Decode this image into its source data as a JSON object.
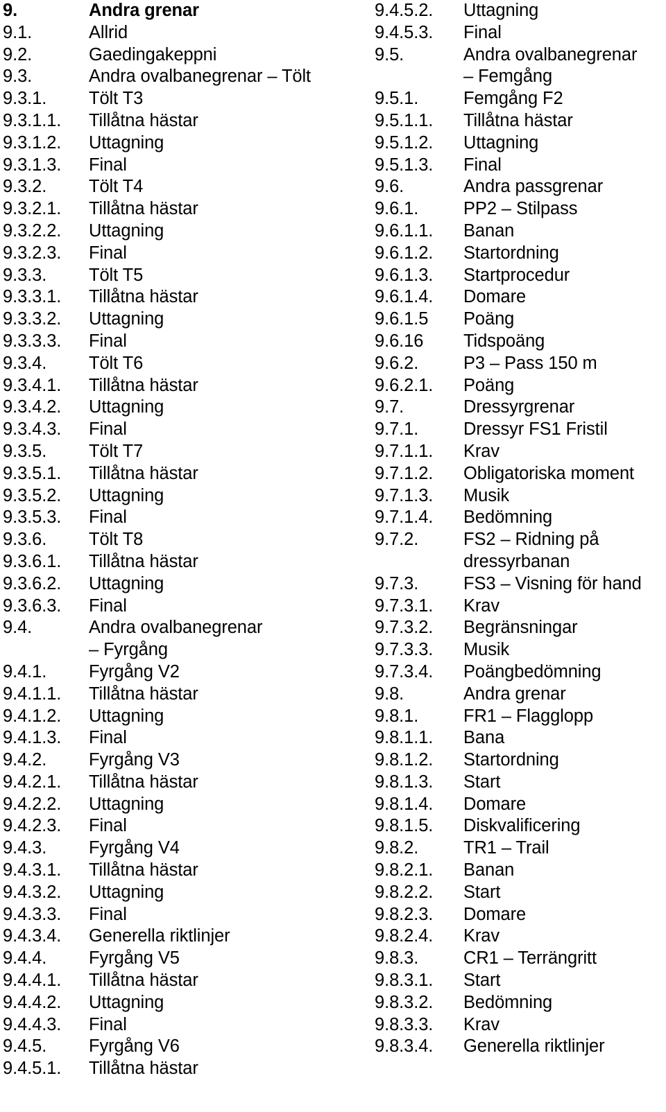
{
  "document": {
    "type": "table-of-contents",
    "language": "sv",
    "heading_number": "9.",
    "heading_label": "Andra grenar"
  },
  "columns": {
    "left": {
      "name": "left-column",
      "entries": [
        {
          "num": "9.",
          "label": "Andra grenar",
          "bold": true
        },
        {
          "num": "9.1.",
          "label": "Allrid",
          "bold": false
        },
        {
          "num": "9.2.",
          "label": "Gaedingakeppni",
          "bold": false
        },
        {
          "num": "9.3.",
          "label": "Andra ovalbanegrenar – Tölt",
          "bold": false
        },
        {
          "num": "9.3.1.",
          "label": "Tölt T3",
          "bold": false
        },
        {
          "num": "9.3.1.1.",
          "label": "Tillåtna hästar",
          "bold": false
        },
        {
          "num": "9.3.1.2.",
          "label": "Uttagning",
          "bold": false
        },
        {
          "num": "9.3.1.3.",
          "label": "Final",
          "bold": false
        },
        {
          "num": "9.3.2.",
          "label": "Tölt T4",
          "bold": false
        },
        {
          "num": "9.3.2.1.",
          "label": "Tillåtna hästar",
          "bold": false
        },
        {
          "num": "9.3.2.2.",
          "label": "Uttagning",
          "bold": false
        },
        {
          "num": "9.3.2.3.",
          "label": "Final",
          "bold": false
        },
        {
          "num": "9.3.3.",
          "label": "Tölt T5",
          "bold": false
        },
        {
          "num": "9.3.3.1.",
          "label": "Tillåtna hästar",
          "bold": false
        },
        {
          "num": "9.3.3.2.",
          "label": "Uttagning",
          "bold": false
        },
        {
          "num": "9.3.3.3.",
          "label": "Final",
          "bold": false
        },
        {
          "num": "9.3.4.",
          "label": "Tölt T6",
          "bold": false
        },
        {
          "num": "9.3.4.1.",
          "label": "Tillåtna hästar",
          "bold": false
        },
        {
          "num": "9.3.4.2.",
          "label": "Uttagning",
          "bold": false
        },
        {
          "num": "9.3.4.3.",
          "label": "Final",
          "bold": false
        },
        {
          "num": "9.3.5.",
          "label": "Tölt T7",
          "bold": false
        },
        {
          "num": "9.3.5.1.",
          "label": "Tillåtna hästar",
          "bold": false
        },
        {
          "num": "9.3.5.2.",
          "label": "Uttagning",
          "bold": false
        },
        {
          "num": "9.3.5.3.",
          "label": "Final",
          "bold": false
        },
        {
          "num": "9.3.6.",
          "label": "Tölt T8",
          "bold": false
        },
        {
          "num": "9.3.6.1.",
          "label": "Tillåtna hästar",
          "bold": false
        },
        {
          "num": "9.3.6.2.",
          "label": "Uttagning",
          "bold": false
        },
        {
          "num": "9.3.6.3.",
          "label": "Final",
          "bold": false
        },
        {
          "num": "9.4.",
          "label": "Andra ovalbanegrenar\n– Fyrgång",
          "bold": false
        },
        {
          "num": "9.4.1.",
          "label": "Fyrgång V2",
          "bold": false
        },
        {
          "num": "9.4.1.1.",
          "label": "Tillåtna hästar",
          "bold": false
        },
        {
          "num": "9.4.1.2.",
          "label": "Uttagning",
          "bold": false
        },
        {
          "num": "9.4.1.3.",
          "label": "Final",
          "bold": false
        },
        {
          "num": "9.4.2.",
          "label": "Fyrgång V3",
          "bold": false
        },
        {
          "num": "9.4.2.1.",
          "label": "Tillåtna hästar",
          "bold": false
        },
        {
          "num": "9.4.2.2.",
          "label": "Uttagning",
          "bold": false
        },
        {
          "num": "9.4.2.3.",
          "label": "Final",
          "bold": false
        },
        {
          "num": "9.4.3.",
          "label": "Fyrgång V4",
          "bold": false
        },
        {
          "num": "9.4.3.1.",
          "label": "Tillåtna hästar",
          "bold": false
        },
        {
          "num": "9.4.3.2.",
          "label": "Uttagning",
          "bold": false
        },
        {
          "num": "9.4.3.3.",
          "label": "Final",
          "bold": false
        },
        {
          "num": "9.4.3.4.",
          "label": "Generella riktlinjer",
          "bold": false
        },
        {
          "num": "9.4.4.",
          "label": "Fyrgång V5",
          "bold": false
        },
        {
          "num": "9.4.4.1.",
          "label": "Tillåtna hästar",
          "bold": false
        },
        {
          "num": "9.4.4.2.",
          "label": "Uttagning",
          "bold": false
        },
        {
          "num": "9.4.4.3.",
          "label": "Final",
          "bold": false
        },
        {
          "num": "9.4.5.",
          "label": "Fyrgång V6",
          "bold": false
        },
        {
          "num": "9.4.5.1.",
          "label": "Tillåtna hästar",
          "bold": false
        }
      ]
    },
    "right": {
      "name": "right-column",
      "entries": [
        {
          "num": "9.4.5.2.",
          "label": "Uttagning",
          "bold": false
        },
        {
          "num": "9.4.5.3.",
          "label": "Final",
          "bold": false
        },
        {
          "num": "9.5.",
          "label": "Andra ovalbanegrenar\n– Femgång",
          "bold": false
        },
        {
          "num": "9.5.1.",
          "label": "Femgång F2",
          "bold": false
        },
        {
          "num": "9.5.1.1.",
          "label": "Tillåtna hästar",
          "bold": false
        },
        {
          "num": "9.5.1.2.",
          "label": "Uttagning",
          "bold": false
        },
        {
          "num": "9.5.1.3.",
          "label": "Final",
          "bold": false
        },
        {
          "num": "9.6.",
          "label": "Andra passgrenar",
          "bold": false
        },
        {
          "num": "9.6.1.",
          "label": "PP2 – Stilpass",
          "bold": false
        },
        {
          "num": "9.6.1.1.",
          "label": "Banan",
          "bold": false
        },
        {
          "num": "9.6.1.2.",
          "label": "Startordning",
          "bold": false
        },
        {
          "num": "9.6.1.3.",
          "label": "Startprocedur",
          "bold": false
        },
        {
          "num": "9.6.1.4.",
          "label": "Domare",
          "bold": false
        },
        {
          "num": "9.6.1.5",
          "label": "Poäng",
          "bold": false
        },
        {
          "num": "9.6.16",
          "label": "Tidspoäng",
          "bold": false
        },
        {
          "num": "9.6.2.",
          "label": "P3 – Pass 150 m",
          "bold": false
        },
        {
          "num": "9.6.2.1.",
          "label": "Poäng",
          "bold": false
        },
        {
          "num": "9.7.",
          "label": "Dressyrgrenar",
          "bold": false
        },
        {
          "num": "9.7.1.",
          "label": "Dressyr FS1 Fristil",
          "bold": false
        },
        {
          "num": "9.7.1.1.",
          "label": "Krav",
          "bold": false
        },
        {
          "num": "9.7.1.2.",
          "label": "Obligatoriska moment",
          "bold": false
        },
        {
          "num": "9.7.1.3.",
          "label": "Musik",
          "bold": false
        },
        {
          "num": "9.7.1.4.",
          "label": "Bedömning",
          "bold": false
        },
        {
          "num": "9.7.2.",
          "label": "FS2 – Ridning på\ndressyrbanan",
          "bold": false
        },
        {
          "num": "9.7.3.",
          "label": "FS3 – Visning för hand",
          "bold": false
        },
        {
          "num": "9.7.3.1.",
          "label": "Krav",
          "bold": false
        },
        {
          "num": "9.7.3.2.",
          "label": "Begränsningar",
          "bold": false
        },
        {
          "num": "9.7.3.3.",
          "label": "Musik",
          "bold": false
        },
        {
          "num": "9.7.3.4.",
          "label": "Poängbedömning",
          "bold": false
        },
        {
          "num": "9.8.",
          "label": "Andra grenar",
          "bold": false
        },
        {
          "num": "9.8.1.",
          "label": "FR1 – Flagglopp",
          "bold": false
        },
        {
          "num": "9.8.1.1.",
          "label": "Bana",
          "bold": false
        },
        {
          "num": "9.8.1.2.",
          "label": "Startordning",
          "bold": false
        },
        {
          "num": "9.8.1.3.",
          "label": "Start",
          "bold": false
        },
        {
          "num": "9.8.1.4.",
          "label": "Domare",
          "bold": false
        },
        {
          "num": "9.8.1.5.",
          "label": "Diskvalificering",
          "bold": false
        },
        {
          "num": "9.8.2.",
          "label": "TR1 – Trail",
          "bold": false
        },
        {
          "num": "9.8.2.1.",
          "label": "Banan",
          "bold": false
        },
        {
          "num": "9.8.2.2.",
          "label": "Start",
          "bold": false
        },
        {
          "num": "9.8.2.3.",
          "label": "Domare",
          "bold": false
        },
        {
          "num": "9.8.2.4.",
          "label": "Krav",
          "bold": false
        },
        {
          "num": "9.8.3.",
          "label": "CR1 – Terrängritt",
          "bold": false
        },
        {
          "num": "9.8.3.1.",
          "label": "Start",
          "bold": false
        },
        {
          "num": "9.8.3.2.",
          "label": "Bedömning",
          "bold": false
        },
        {
          "num": "9.8.3.3.",
          "label": "Krav",
          "bold": false
        },
        {
          "num": "9.8.3.4.",
          "label": "Generella riktlinjer",
          "bold": false
        }
      ]
    }
  }
}
